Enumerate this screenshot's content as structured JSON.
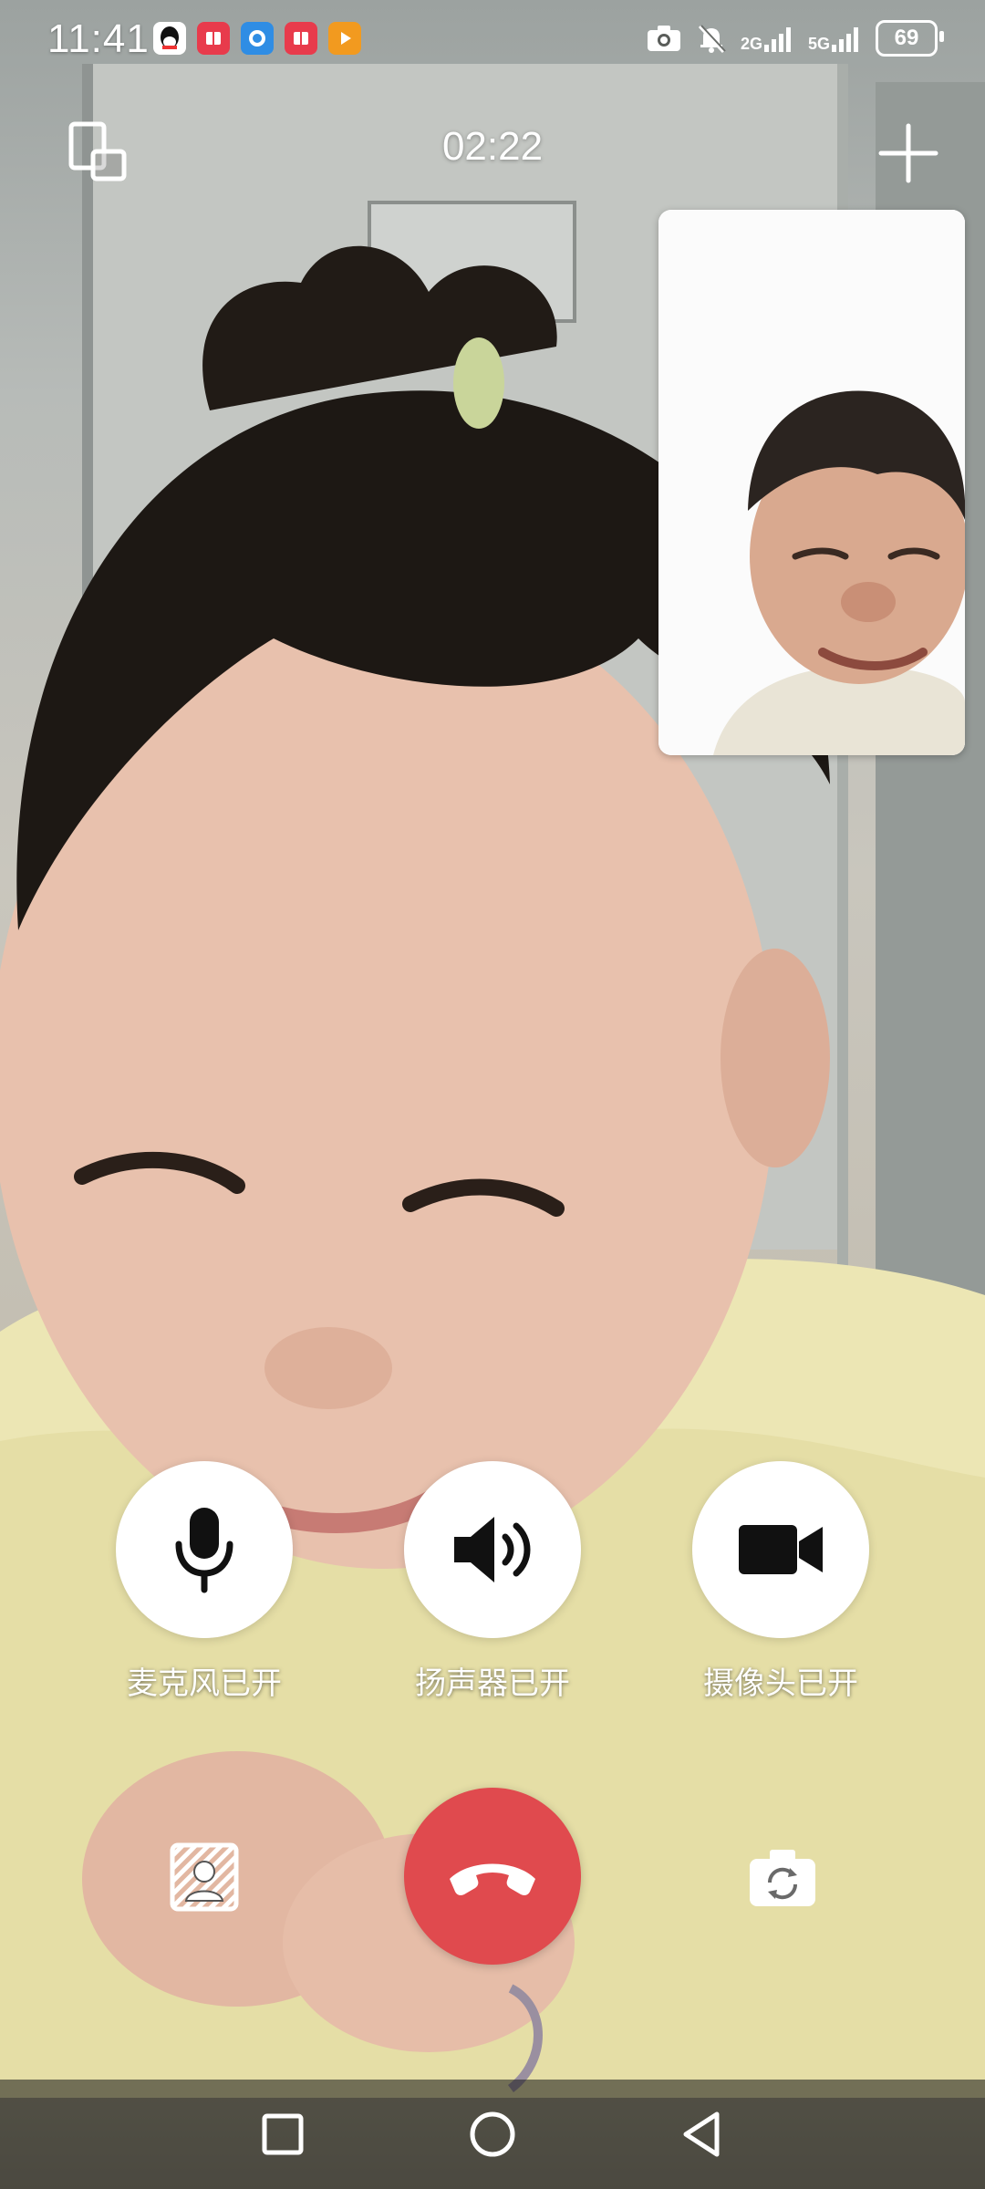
{
  "status_bar": {
    "time": "11:41",
    "network_1": "2G",
    "network_2": "5G",
    "battery": "69",
    "notification_icons": [
      "qq-icon",
      "red-app-icon",
      "blue-app-icon",
      "red-app-icon",
      "orange-video-icon"
    ]
  },
  "call": {
    "timer": "02:22"
  },
  "controls": {
    "microphone_label": "麦克风已开",
    "speaker_label": "扬声器已开",
    "camera_label": "摄像头已开"
  },
  "colors": {
    "hangup": "#e04a4e",
    "button_bg": "#ffffff",
    "icon_dark": "#111111"
  }
}
